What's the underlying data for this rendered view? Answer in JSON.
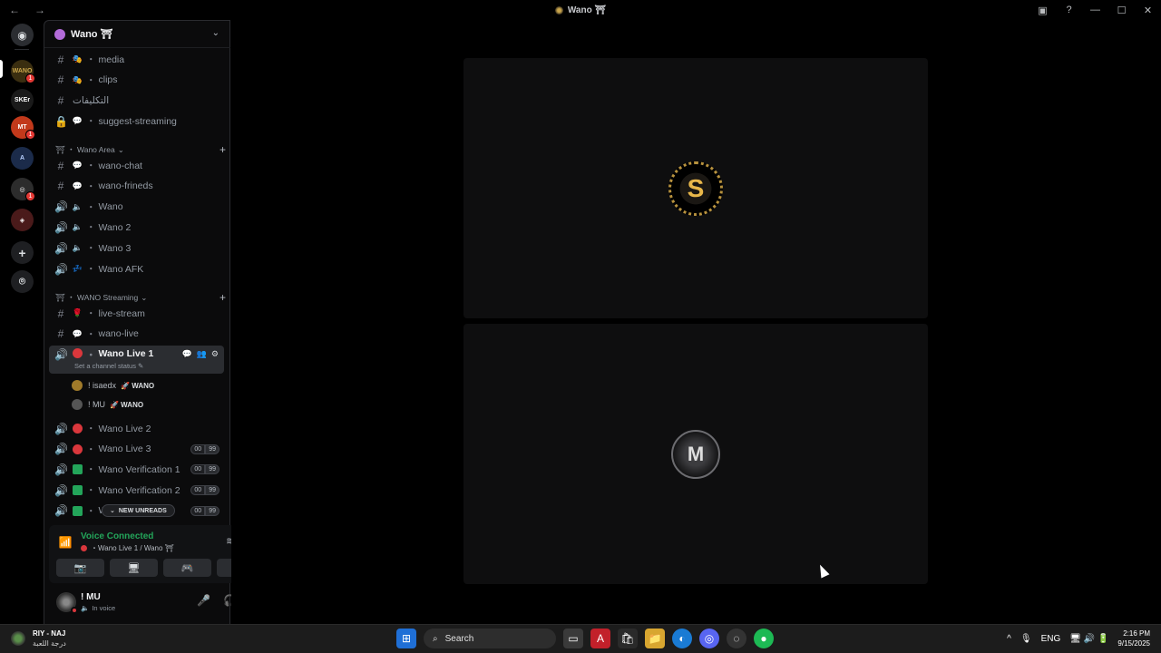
{
  "window": {
    "title": "Wano ⛩",
    "back": "←",
    "forward": "→",
    "controls": {
      "inbox": "▣",
      "help": "?",
      "minimize": "—",
      "maximize": "☐",
      "close": "✕"
    }
  },
  "rail": {
    "discord_home": "◉",
    "servers": [
      {
        "label": "WANO",
        "color": "#3a2e10",
        "text_color": "#c9a54b",
        "badge": "1"
      },
      {
        "label": "SKEr",
        "color": "#1a1a1a",
        "text_color": "#ffffff",
        "badge": ""
      },
      {
        "label": "MT",
        "color": "#c2391b",
        "text_color": "#ffffff",
        "badge": "1"
      },
      {
        "label": "A",
        "color": "#1b2b4a",
        "text_color": "#b9d1ff",
        "badge": ""
      },
      {
        "label": "◎",
        "color": "#2c2c2c",
        "text_color": "#ffffff",
        "badge": "1"
      },
      {
        "label": "◈",
        "color": "#4a1a1a",
        "text_color": "#ffffff",
        "badge": ""
      }
    ],
    "add_server": "+",
    "discover": "⌾"
  },
  "server": {
    "name": "Wano ⛩",
    "chevron": "⌄"
  },
  "channels_top": [
    {
      "type": "#",
      "emoji": "🎭",
      "name": "media"
    },
    {
      "type": "#",
      "emoji": "🎭",
      "name": "clips"
    },
    {
      "type": "#",
      "emoji": "",
      "name": "التكليفات"
    },
    {
      "type": "🔒",
      "emoji": "💬",
      "name": "suggest-streaming"
    }
  ],
  "category1": {
    "name": "⛩ ・ Wano Area",
    "caret": "⌄",
    "plus": "+"
  },
  "channels_area": [
    {
      "type": "#",
      "emoji": "💬",
      "name": "wano-chat"
    },
    {
      "type": "#",
      "emoji": "💬",
      "name": "wano-frineds"
    },
    {
      "type": "🔊",
      "emoji": "🔈",
      "name": "Wano"
    },
    {
      "type": "🔊",
      "emoji": "🔈",
      "name": "Wano 2"
    },
    {
      "type": "🔊",
      "emoji": "🔈",
      "name": "Wano 3"
    },
    {
      "type": "🔊",
      "emoji": "💤",
      "name": "Wano AFK"
    }
  ],
  "category2": {
    "name": "⛩ ・ WANO Streaming",
    "caret": "⌄",
    "plus": "+"
  },
  "channels_stream": [
    {
      "type": "#",
      "emoji": "🌹",
      "name": "live-stream"
    },
    {
      "type": "#",
      "emoji": "💬",
      "name": "wano-live"
    }
  ],
  "active_channel": {
    "type": "🔊",
    "name": "Wano Live 1",
    "status": "Set a channel status ✎",
    "tools": [
      "💬",
      "👥",
      "⚙"
    ]
  },
  "members": [
    {
      "name": "! isaedx",
      "tag": "🚀 WANO",
      "avatar_color": "#a07a2a"
    },
    {
      "name": "! MU",
      "tag": "🚀 WANO",
      "avatar_color": "#555555"
    }
  ],
  "channels_after": [
    {
      "type": "🔊",
      "dot": "#da373c",
      "name": "Wano Live 2",
      "counts": []
    },
    {
      "type": "🔊",
      "dot": "#da373c",
      "name": "Wano Live 3",
      "counts": [
        "00",
        "99"
      ]
    },
    {
      "type": "🔊",
      "dot": "#23a55a",
      "name": "Wano Verification 1",
      "counts": [
        "00",
        "99"
      ]
    },
    {
      "type": "🔊",
      "dot": "#23a55a",
      "name": "Wano Verification 2",
      "counts": [
        "00",
        "99"
      ]
    },
    {
      "type": "🔊",
      "dot": "#23a55a",
      "name": "W",
      "counts": [
        "00",
        "99"
      ]
    }
  ],
  "new_unreads": "NEW UNREADS",
  "voice": {
    "title": "Voice Connected",
    "subtitle": "・Wano Live 1 / Wano ⛩",
    "noise_icon": "≋",
    "disconnect_icon": "☎",
    "buttons": [
      "📷",
      "🖥",
      "🎮",
      "🚀"
    ]
  },
  "user": {
    "name": "! MU",
    "status": "In voice",
    "controls": [
      "🎤",
      "🎧",
      "⚙"
    ]
  },
  "stage": {
    "tile1_logo": "S",
    "tile2_logo": "M"
  },
  "taskbar": {
    "weather_title": "RIY - NAJ",
    "weather_sub": "درجة اللعبة",
    "search": "Search",
    "apps": [
      "⊞",
      "🔍",
      "▭",
      "A",
      "🛍",
      "📁",
      "◐",
      "◎",
      "◌",
      "●"
    ],
    "tray_up": "^",
    "tray_mic": "🎙",
    "lang": "ENG",
    "tray_icons": "🖥 🔊 🔋",
    "time": "2:16 PM",
    "date": "9/15/2025"
  }
}
